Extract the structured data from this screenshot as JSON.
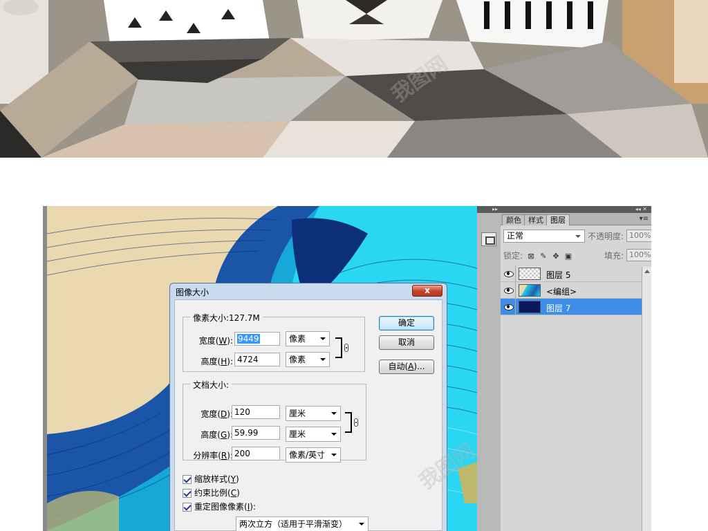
{
  "dialog": {
    "title": "图像大小",
    "close_label": "x",
    "pixel_dimensions": {
      "title": "像素大小:127.7M",
      "width_label": "宽度(",
      "width_key": "W",
      "width_value": "9449",
      "width_unit": "像素",
      "height_label": "高度(",
      "height_key": "H",
      "height_value": "4724",
      "height_unit": "像素"
    },
    "document_size": {
      "title": "文档大小:",
      "width_label": "宽度(",
      "width_key": "D",
      "width_value": "120",
      "width_unit": "厘米",
      "height_label": "高度(",
      "height_key": "G",
      "height_value": "59.99",
      "height_unit": "厘米",
      "resolution_label": "分辨率(",
      "resolution_key": "R",
      "resolution_value": "200",
      "resolution_unit": "像素/英寸"
    },
    "label_suffix": "):",
    "buttons": {
      "ok": "确定",
      "cancel": "取消",
      "auto": "自动(",
      "auto_key": "A",
      "auto_suffix": ")..."
    },
    "checkboxes": [
      {
        "label": "缩放样式(",
        "key": "Y",
        "suffix": ")",
        "checked": true
      },
      {
        "label": "约束比例(",
        "key": "C",
        "suffix": ")",
        "checked": true
      },
      {
        "label": "重定图像像素(",
        "key": "I",
        "suffix": "):",
        "checked": true
      }
    ],
    "resample_method": "两次立方（适用于平滑渐变）"
  },
  "layers_panel": {
    "collapse_arrows": "▸▸",
    "right_arrows": "◂◂ ✕",
    "tabs": [
      "颜色",
      "样式",
      "图层"
    ],
    "active_tab": "图层",
    "panel_menu": "▾≡",
    "blend_mode": "正常",
    "opacity_label": "不透明度:",
    "opacity_value": "100%",
    "lock_label": "锁定:",
    "fill_label": "填充:",
    "fill_value": "100%",
    "layers": [
      {
        "name": "图层 5",
        "selected": false,
        "thumb": "transparent"
      },
      {
        "name": "<编组>",
        "selected": false,
        "thumb": "artwork"
      },
      {
        "name": "图层 7",
        "selected": true,
        "thumb": "navy"
      }
    ]
  },
  "watermark_text": "我图网",
  "colors": {
    "dialog_title_bg": "#c9dbee",
    "selected_layer": "#3d8ee8",
    "artwork_cream": "#e9dcb8",
    "artwork_cyan": "#27d3ef",
    "artwork_blue": "#1d5fb1",
    "artwork_navy": "#0b1a5c"
  }
}
